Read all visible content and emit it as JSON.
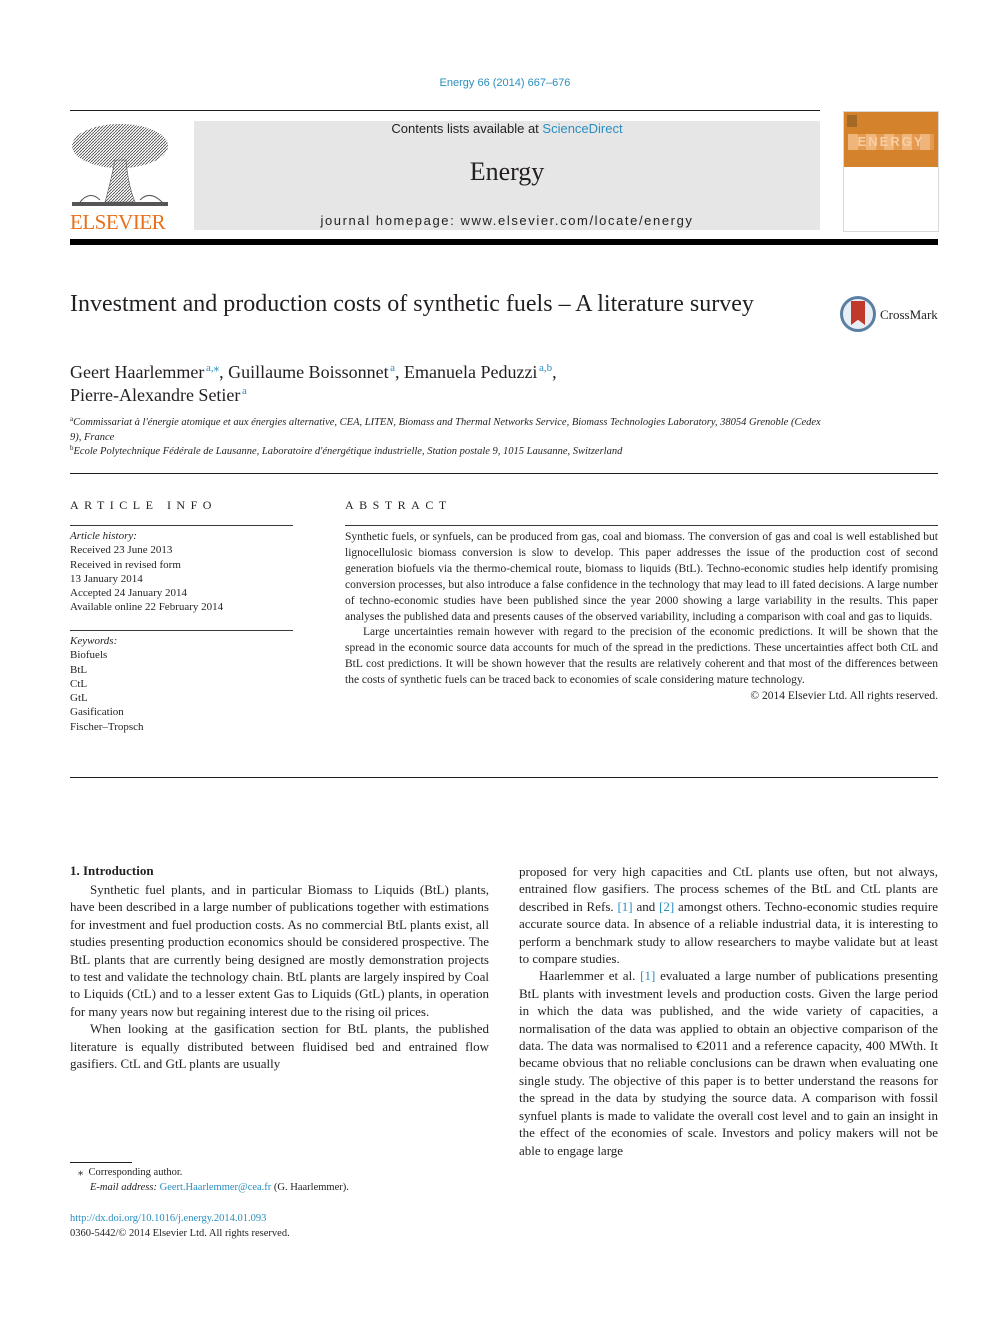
{
  "header": {
    "citation": "Energy 66 (2014) 667–676",
    "contents_prefix": "Contents lists available at ",
    "contents_link": "ScienceDirect",
    "journal_title": "Energy",
    "homepage": "journal homepage: www.elsevier.com/locate/energy",
    "publisher_logo_text": "ELSEVIER",
    "cover_word": "ENERGY",
    "crossmark_label": "CrossMark"
  },
  "article": {
    "title": "Investment and production costs of synthetic fuels – A literature survey",
    "authors": [
      {
        "name": "Geert Haarlemmer",
        "sup": "a,⁎"
      },
      {
        "name": "Guillaume Boissonnet",
        "sup": "a"
      },
      {
        "name": "Emanuela Peduzzi",
        "sup": "a,b"
      },
      {
        "name": "Pierre-Alexandre Setier",
        "sup": "a"
      }
    ],
    "affiliations": [
      {
        "sup": "a",
        "text": "Commissariat à l'énergie atomique et aux énergies alternative, CEA, LITEN, Biomass and Thermal Networks Service, Biomass Technologies Laboratory, 38054 Grenoble (Cedex 9), France"
      },
      {
        "sup": "b",
        "text": "Ecole Polytechnique Fédérale de Lausanne, Laboratoire d'énergétique industrielle, Station postale 9, 1015 Lausanne, Switzerland"
      }
    ]
  },
  "article_info": {
    "heading": "ARTICLE INFO",
    "history_label": "Article history:",
    "history": [
      "Received 23 June 2013",
      "Received in revised form",
      "13 January 2014",
      "Accepted 24 January 2014",
      "Available online 22 February 2014"
    ],
    "keywords_label": "Keywords:",
    "keywords": [
      "Biofuels",
      "BtL",
      "CtL",
      "GtL",
      "Gasification",
      "Fischer–Tropsch"
    ]
  },
  "abstract": {
    "heading": "ABSTRACT",
    "paragraphs": [
      "Synthetic fuels, or synfuels, can be produced from gas, coal and biomass. The conversion of gas and coal is well established but lignocellulosic biomass conversion is slow to develop. This paper addresses the issue of the production cost of second generation biofuels via the thermo-chemical route, biomass to liquids (BtL). Techno-economic studies help identify promising conversion processes, but also introduce a false confidence in the technology that may lead to ill fated decisions. A large number of techno-economic studies have been published since the year 2000 showing a large variability in the results. This paper analyses the published data and presents causes of the observed variability, including a comparison with coal and gas to liquids.",
      "Large uncertainties remain however with regard to the precision of the economic predictions. It will be shown that the spread in the economic source data accounts for much of the spread in the predictions. These uncertainties affect both CtL and BtL cost predictions. It will be shown however that the results are relatively coherent and that most of the differences between the costs of synthetic fuels can be traced back to economies of scale considering mature technology."
    ],
    "copyright": "© 2014 Elsevier Ltd. All rights reserved."
  },
  "body": {
    "section_heading": "1.  Introduction",
    "col1": {
      "p1": "Synthetic fuel plants, and in particular Biomass to Liquids (BtL) plants, have been described in a large number of publications together with estimations for investment and fuel production costs. As no commercial BtL plants exist, all studies presenting production economics should be considered prospective. The BtL plants that are currently being designed are mostly demonstration projects to test and validate the technology chain. BtL plants are largely inspired by Coal to Liquids (CtL) and to a lesser extent Gas to Liquids (GtL) plants, in operation for many years now but regaining interest due to the rising oil prices.",
      "p2": "When looking at the gasification section for BtL plants, the published literature is equally distributed between fluidised bed and entrained flow gasifiers. CtL and GtL plants are usually"
    },
    "col2": {
      "p1_a": "proposed for very high capacities and CtL plants use often, but not always, entrained flow gasifiers. The process schemes of the BtL and CtL plants are described in Refs. ",
      "ref1": "[1]",
      "p1_b": " and ",
      "ref2": "[2]",
      "p1_c": " amongst others. Techno-economic studies require accurate source data. In absence of a reliable industrial data, it is interesting to perform a benchmark study to allow researchers to maybe validate but at least to compare studies.",
      "p2_a": "Haarlemmer et al. ",
      "p2_ref": "[1]",
      "p2_b": " evaluated a large number of publications presenting BtL plants with investment levels and production costs. Given the large period in which the data was published, and the wide variety of capacities, a normalisation of the data was applied to obtain an objective comparison of the data. The data was normalised to €2011 and a reference capacity, 400 MWth. It became obvious that no reliable conclusions can be drawn when evaluating one single study. The objective of this paper is to better understand the reasons for the spread in the data by studying the source data. A comparison with fossil synfuel plants is made to validate the overall cost level and to gain an insight in the effect of the economies of scale. Investors and policy makers will not be able to engage large"
    }
  },
  "footnote": {
    "marker": "⁎",
    "corresponding": "Corresponding author.",
    "email_label": "E-mail address: ",
    "email": "Geert.Haarlemmer@cea.fr",
    "email_suffix": " (G. Haarlemmer).",
    "doi": "http://dx.doi.org/10.1016/j.energy.2014.01.093",
    "issn_line": "0360-5442/© 2014 Elsevier Ltd. All rights reserved."
  }
}
